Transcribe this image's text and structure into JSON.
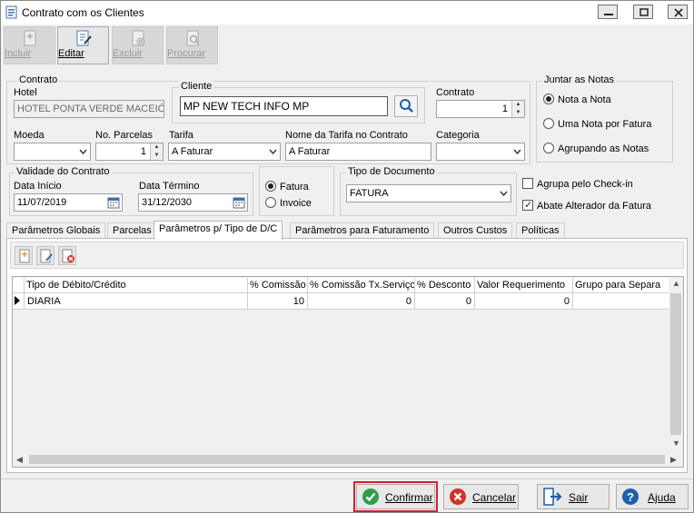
{
  "window": {
    "title": "Contrato com os Clientes",
    "app_icon": "document-icon",
    "controls": [
      "minimize",
      "restore",
      "close"
    ]
  },
  "toolbar": {
    "incluir": "Incluir",
    "editar": "Editar",
    "excluir": "Excluir",
    "procurar": "Procurar"
  },
  "contrato_group": {
    "title": "Contrato"
  },
  "hotel": {
    "label": "Hotel",
    "value": "HOTEL PONTA VERDE MACEIÓ"
  },
  "cliente": {
    "title": "Cliente",
    "value": "MP NEW TECH INFO MP",
    "search_icon": "search-icon"
  },
  "contrato_num": {
    "label": "Contrato",
    "value": "1"
  },
  "moeda": {
    "label": "Moeda",
    "value": ""
  },
  "parcelas": {
    "label": "No. Parcelas",
    "value": "1"
  },
  "tarifa": {
    "label": "Tarifa",
    "value": "A Faturar"
  },
  "nome_tarifa": {
    "label": "Nome da Tarifa no Contrato",
    "value": "A Faturar"
  },
  "categoria": {
    "label": "Categoria",
    "value": ""
  },
  "juntar": {
    "title": "Juntar as Notas",
    "options": [
      "Nota a Nota",
      "Uma Nota por Fatura",
      "Agrupando as Notas"
    ],
    "selected": 0
  },
  "validade": {
    "title": "Validade do Contrato",
    "inicio_label": "Data Início",
    "inicio": "11/07/2019",
    "termino_label": "Data Término",
    "termino": "31/12/2030"
  },
  "fatura_opts": {
    "options": [
      "Fatura",
      "Invoice"
    ],
    "selected": 0
  },
  "tipo_doc": {
    "title": "Tipo de Documento",
    "value": "FATURA"
  },
  "checks": {
    "agrupa": {
      "label": "Agrupa pelo Check-in",
      "checked": false
    },
    "abate": {
      "label": "Abate Alterador da Fatura",
      "checked": true
    }
  },
  "tabs": [
    "Parâmetros Globais",
    "Parcelas",
    "Parâmetros p/ Tipo de D/C",
    "Parâmetros para Faturamento",
    "Outros Custos",
    "Políticas"
  ],
  "active_tab": 2,
  "grid": {
    "columns": [
      "Tipo de Débito/Crédito",
      "% Comissão",
      "% Comissão Tx.Serviço",
      "% Desconto",
      "Valor Requerimento",
      "Grupo para Separa"
    ],
    "rows": [
      [
        "DIARIA",
        "10",
        "0",
        "0",
        "0",
        ""
      ]
    ]
  },
  "buttons": {
    "confirmar": "Confirmar",
    "cancelar": "Cancelar",
    "sair": "Sair",
    "ajuda": "Ajuda"
  },
  "colors": {
    "focus_outline": "#d0202f",
    "confirm_green": "#2e9e48",
    "cancel_red": "#d0322a",
    "help_blue": "#1f5fa8"
  }
}
